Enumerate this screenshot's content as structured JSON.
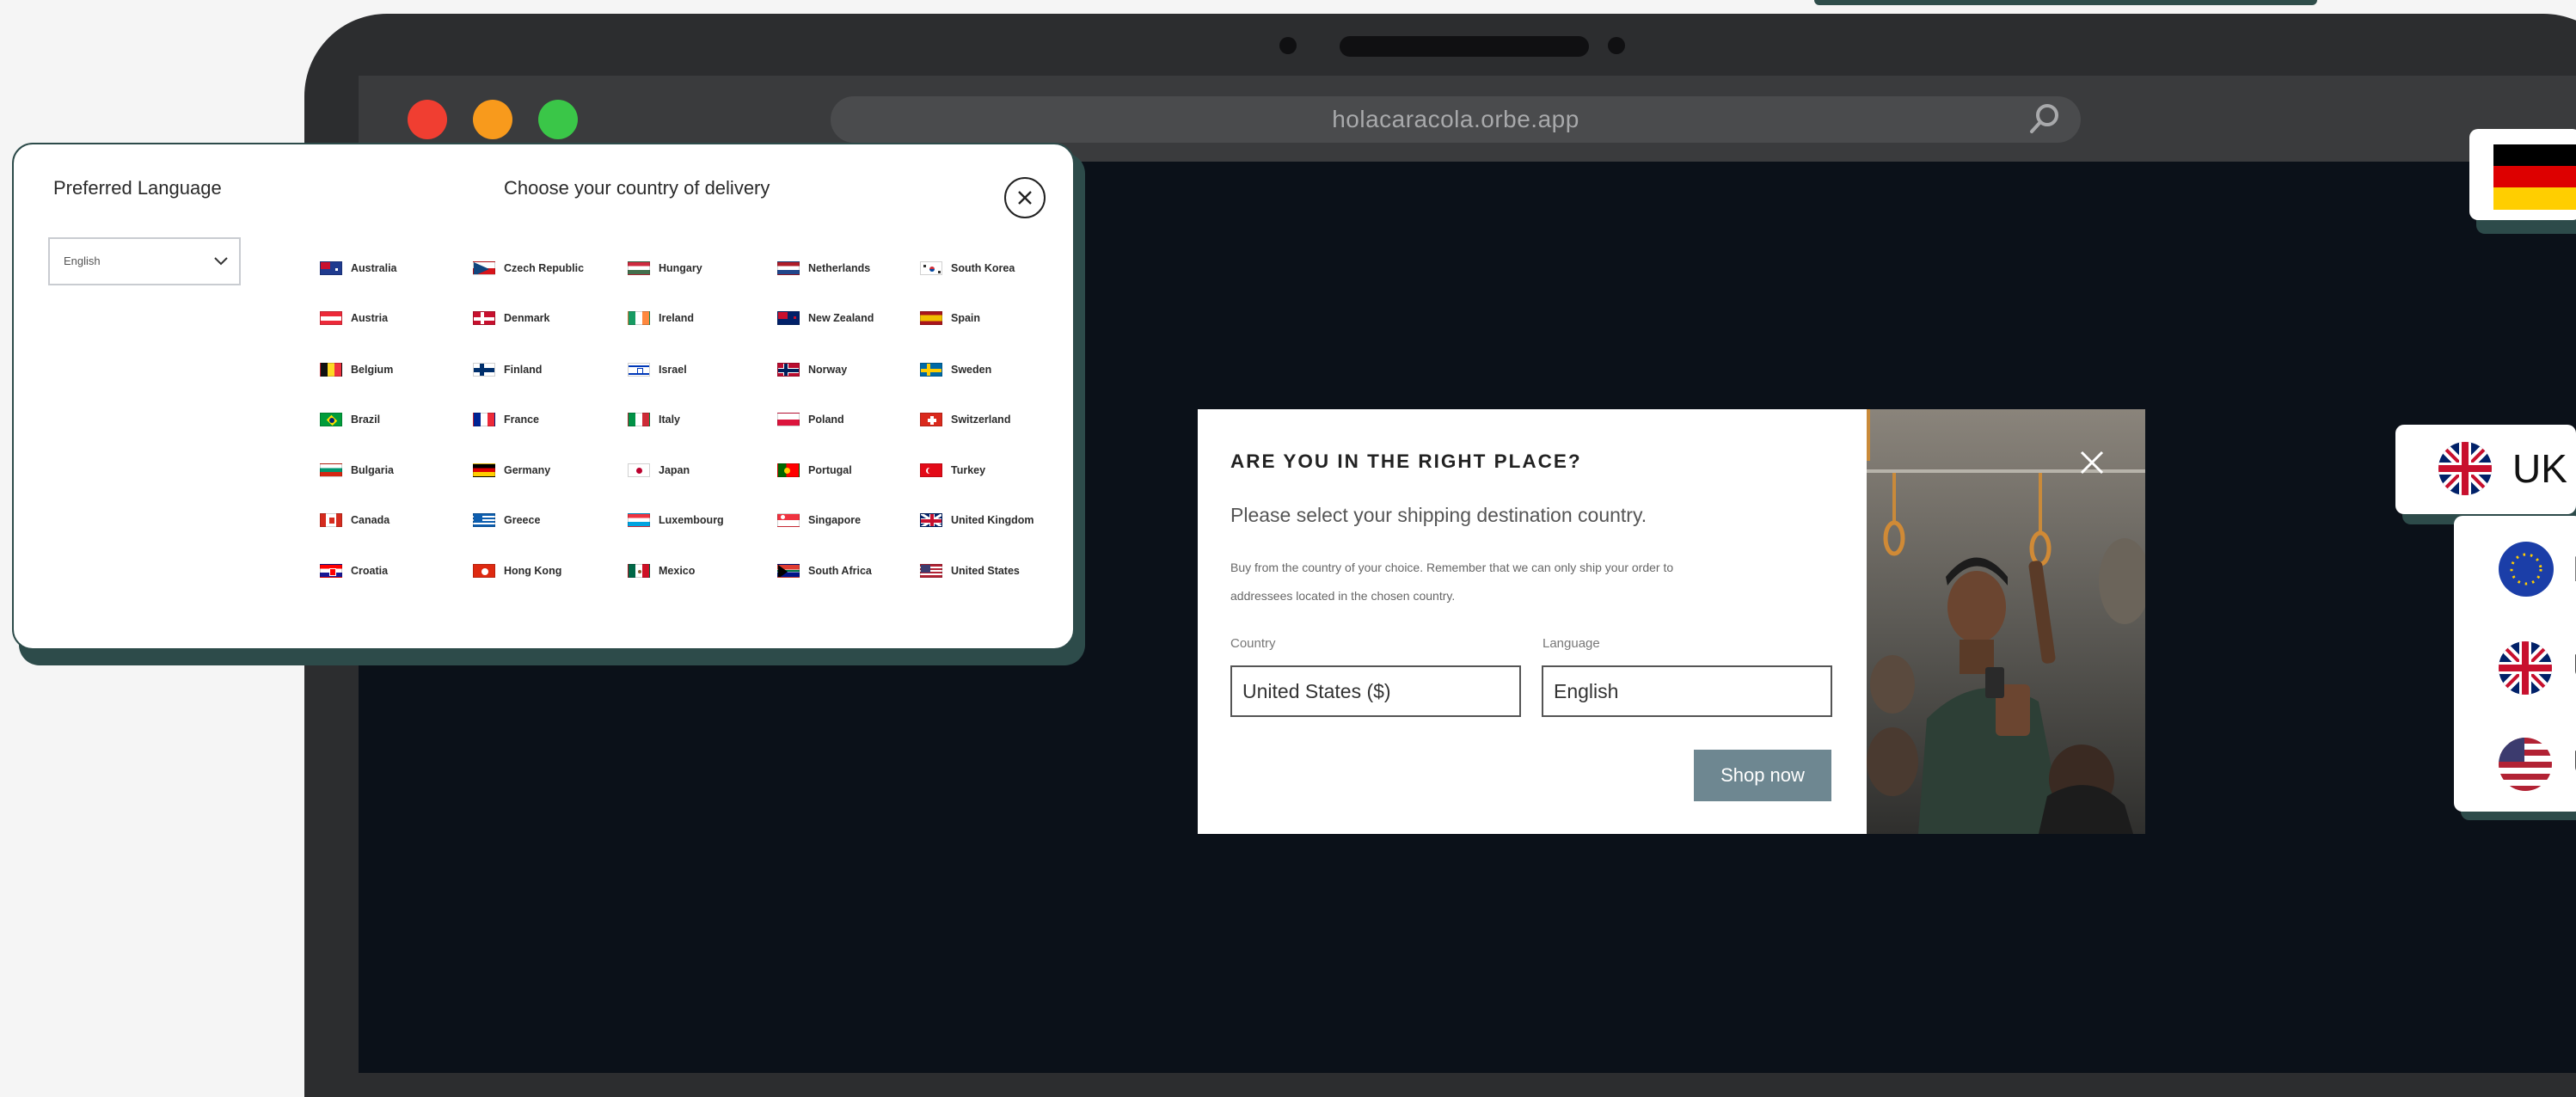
{
  "browser": {
    "url": "holacaracola.orbe.app",
    "traffic_lights": [
      "#f03e31",
      "#f89a1c",
      "#3ac648"
    ]
  },
  "country_popup": {
    "language_heading": "Preferred Language",
    "language_value": "English",
    "country_heading": "Choose your country of delivery",
    "columns": [
      [
        "Australia",
        "Austria",
        "Belgium",
        "Brazil",
        "Bulgaria",
        "Canada",
        "Croatia"
      ],
      [
        "Czech Republic",
        "Denmark",
        "Finland",
        "France",
        "Germany",
        "Greece",
        "Hong Kong"
      ],
      [
        "Hungary",
        "Ireland",
        "Israel",
        "Italy",
        "Japan",
        "Luxembourg",
        "Mexico"
      ],
      [
        "Netherlands",
        "New Zealand",
        "Norway",
        "Poland",
        "Portugal",
        "Singapore",
        "South Africa"
      ],
      [
        "South Korea",
        "Spain",
        "Sweden",
        "Switzerland",
        "Turkey",
        "United Kingdom",
        "United States"
      ]
    ]
  },
  "right_place_modal": {
    "title": "ARE YOU IN THE RIGHT PLACE?",
    "subtitle": "Please select your shipping destination country.",
    "note_line1": "Buy from the country of your choice. Remember that we can only ship your order to",
    "note_line2": "addressees located in the chosen country.",
    "country_label": "Country",
    "country_value": "United States ($)",
    "language_label": "Language",
    "language_value": "English",
    "shop_button": "Shop now"
  },
  "side_cards": {
    "uk_label": "UK",
    "currency_letters": [
      "E",
      "U",
      "U"
    ]
  },
  "colors": {
    "accent_teal": "#2d4b4a",
    "screen_bg": "#0b1119",
    "shop_button": "#6e8791"
  }
}
